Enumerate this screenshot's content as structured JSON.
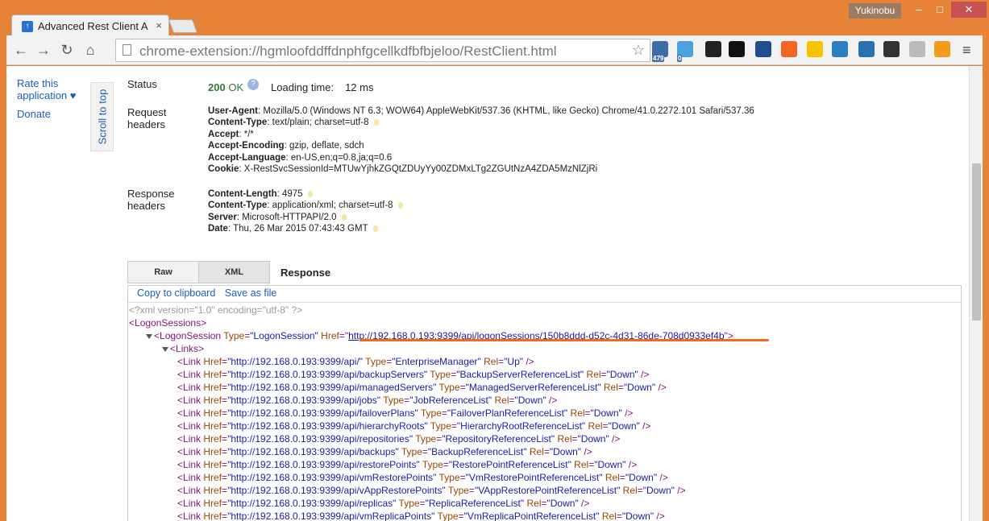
{
  "browser": {
    "tab_title": "Advanced Rest Client A",
    "tab_close": "×",
    "user": "Yukinobu",
    "window_controls": {
      "minimize": "–",
      "maximize": "□",
      "close": "✕"
    },
    "url": "chrome-extension://hgmloofddffdnphfgcellkdfbfbjeloo/RestClient.html",
    "nav_icons": [
      "back-arrow-icon",
      "forward-arrow-icon",
      "reload-icon",
      "home-icon"
    ],
    "extensions": [
      {
        "name": "twitter-ext-icon",
        "color": "#3a6ea5",
        "badge": "479"
      },
      {
        "name": "twitter-bird-ext-icon",
        "color": "#4aa3df",
        "badge": "0"
      },
      {
        "name": "phone-ext-icon",
        "color": "#222222",
        "badge": ""
      },
      {
        "name": "color-wheel-ext-icon",
        "color": "#111111",
        "badge": ""
      },
      {
        "name": "analytics-ext-icon",
        "color": "#1f4e8c",
        "badge": ""
      },
      {
        "name": "cart-ext-icon",
        "color": "#f26522",
        "badge": ""
      },
      {
        "name": "w-ext-icon",
        "color": "#f5c400",
        "badge": ""
      },
      {
        "name": "it-ext-icon",
        "color": "#2a7fc0",
        "badge": ""
      },
      {
        "name": "window-ext-icon",
        "color": "#2a6fb0",
        "badge": ""
      },
      {
        "name": "film-ext-icon",
        "color": "#333333",
        "badge": ""
      },
      {
        "name": "speed-ext-icon",
        "color": "#bbbbbb",
        "badge": ""
      },
      {
        "name": "share-ext-icon",
        "color": "#f29b1d",
        "badge": ""
      }
    ]
  },
  "sidebar": {
    "rate_link": "Rate this application ♥",
    "donate_link": "Donate",
    "scroll_top": "Scroll to top"
  },
  "status": {
    "label": "Status",
    "code": "200",
    "text": "OK",
    "loading_label": "Loading time:",
    "loading_value": "12 ms"
  },
  "request_headers": {
    "label": "Request headers",
    "items": [
      {
        "name": "User-Agent",
        "value": "Mozilla/5.0 (Windows NT 6.3; WOW64) AppleWebKit/537.36 (KHTML, like Gecko) Chrome/41.0.2272.101 Safari/537.36",
        "key": false
      },
      {
        "name": "Content-Type",
        "value": "text/plain; charset=utf-8",
        "key": true
      },
      {
        "name": "Accept",
        "value": "*/*",
        "key": false
      },
      {
        "name": "Accept-Encoding",
        "value": "gzip, deflate, sdch",
        "key": false
      },
      {
        "name": "Accept-Language",
        "value": "en-US,en;q=0.8,ja;q=0.6",
        "key": false
      },
      {
        "name": "Cookie",
        "value": "X-RestSvcSessionId=MTUwYjhkZGQtZDUyYy00ZDMxLTg2ZGUtNzA4ZDA5MzNlZjRi",
        "key": false
      }
    ]
  },
  "response_headers": {
    "label": "Response headers",
    "items": [
      {
        "name": "Content-Length",
        "value": "4975",
        "key": true
      },
      {
        "name": "Content-Type",
        "value": "application/xml; charset=utf-8",
        "key": true
      },
      {
        "name": "Server",
        "value": "Microsoft-HTTPAPI/2.0",
        "key": true
      },
      {
        "name": "Date",
        "value": "Thu, 26 Mar 2015 07:43:43 GMT",
        "key": true
      }
    ]
  },
  "response": {
    "tabs": [
      {
        "label": "Raw"
      },
      {
        "label": "XML"
      }
    ],
    "title": "Response",
    "actions": {
      "copy": "Copy to clipboard",
      "save": "Save as file"
    }
  },
  "xml": {
    "declaration": "<?xml version=\"1.0\" encoding=\"utf-8\" ?>",
    "root_tag": "LogonSessions",
    "session": {
      "tag": "LogonSession",
      "type": "LogonSession",
      "href": "http://192.168.0.193:9399/api/logonSessions/150b8ddd-d52c-4d31-86de-708d0933ef4b"
    },
    "links_tag": "Links",
    "links": [
      {
        "href": "http://192.168.0.193:9399/api/",
        "type": "EnterpriseManager",
        "rel": "Up"
      },
      {
        "href": "http://192.168.0.193:9399/api/backupServers",
        "type": "BackupServerReferenceList",
        "rel": "Down"
      },
      {
        "href": "http://192.168.0.193:9399/api/managedServers",
        "type": "ManagedServerReferenceList",
        "rel": "Down"
      },
      {
        "href": "http://192.168.0.193:9399/api/jobs",
        "type": "JobReferenceList",
        "rel": "Down"
      },
      {
        "href": "http://192.168.0.193:9399/api/failoverPlans",
        "type": "FailoverPlanReferenceList",
        "rel": "Down"
      },
      {
        "href": "http://192.168.0.193:9399/api/hierarchyRoots",
        "type": "HierarchyRootReferenceList",
        "rel": "Down"
      },
      {
        "href": "http://192.168.0.193:9399/api/repositories",
        "type": "RepositoryReferenceList",
        "rel": "Down"
      },
      {
        "href": "http://192.168.0.193:9399/api/backups",
        "type": "BackupReferenceList",
        "rel": "Down"
      },
      {
        "href": "http://192.168.0.193:9399/api/restorePoints",
        "type": "RestorePointReferenceList",
        "rel": "Down"
      },
      {
        "href": "http://192.168.0.193:9399/api/vmRestorePoints",
        "type": "VmRestorePointReferenceList",
        "rel": "Down"
      },
      {
        "href": "http://192.168.0.193:9399/api/vAppRestorePoints",
        "type": "VAppRestorePointReferenceList",
        "rel": "Down"
      },
      {
        "href": "http://192.168.0.193:9399/api/replicas",
        "type": "ReplicaReferenceList",
        "rel": "Down"
      },
      {
        "href": "http://192.168.0.193:9399/api/vmReplicaPoints",
        "type": "VmReplicaPointReferenceList",
        "rel": "Down"
      }
    ]
  }
}
